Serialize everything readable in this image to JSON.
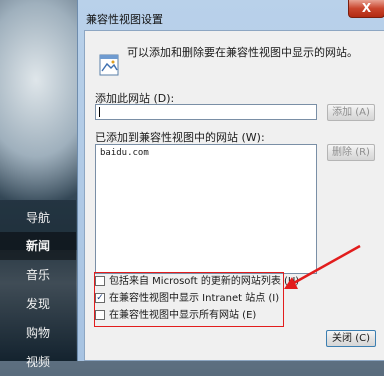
{
  "dialog": {
    "title": "兼容性视图设置",
    "close_glyph": "X",
    "info_text": "可以添加和删除要在兼容性视图中显示的网站。",
    "add_label": "添加此网站 (D):",
    "add_input_value": "",
    "add_button": "添加 (A)",
    "list_label": "已添加到兼容性视图中的网站 (W):",
    "sites": [
      "baidu.com"
    ],
    "remove_button": "删除 (R)",
    "checkboxes": [
      {
        "label": "包括来自 Microsoft 的更新的网站列表 (U)",
        "checked": false
      },
      {
        "label": "在兼容性视图中显示 Intranet 站点 (I)",
        "checked": true
      },
      {
        "label": "在兼容性视图中显示所有网站 (E)",
        "checked": false
      }
    ],
    "close_button": "关闭 (C)"
  },
  "background_nav": {
    "items": [
      "导航",
      "新闻",
      "音乐",
      "发现",
      "购物",
      "视频"
    ],
    "active": "新闻"
  },
  "colors": {
    "highlight": "#e21d1d",
    "dialog_frame": "#b9d1ea"
  }
}
